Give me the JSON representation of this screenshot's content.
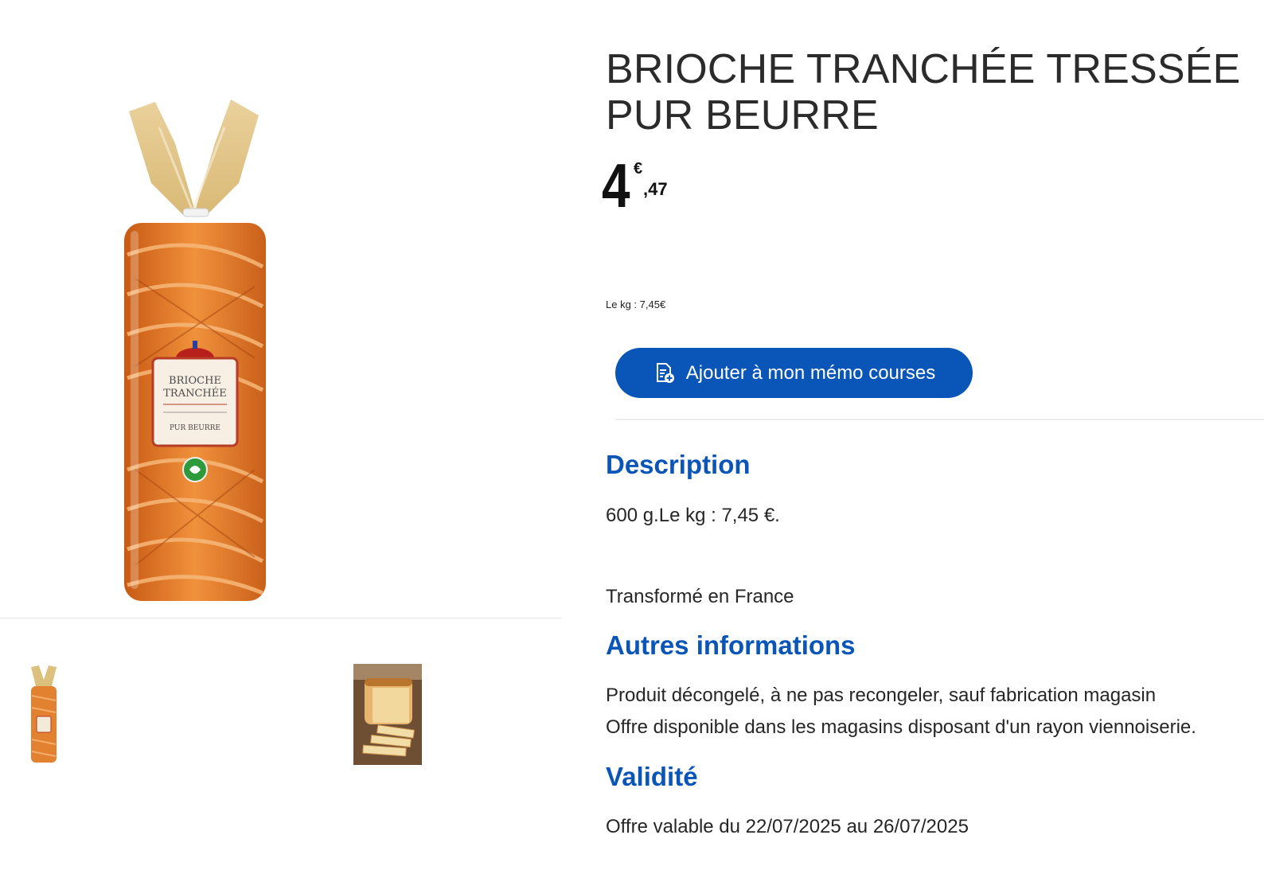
{
  "product": {
    "title": "BRIOCHE TRANCHÉE TRESSÉE PUR BEURRE",
    "price_int": "4",
    "price_currency": "€",
    "price_dec": ",47",
    "unit_price": "Le kg : 7,45€"
  },
  "packaging_text": {
    "line1": "BRIOCHE",
    "line2": "TRANCHÉE",
    "line3": "PUR BEURRE"
  },
  "actions": {
    "memo_label": "Ajouter à mon mémo courses"
  },
  "description": {
    "title": "Description",
    "line1": "600 g.Le kg : 7,45 €.",
    "line2": "Transformé en France"
  },
  "autres": {
    "title": "Autres informations",
    "line1": "Produit décongelé, à ne pas recongeler, sauf fabrication magasin",
    "line2": "Offre disponible dans les magasins disposant d'un rayon viennoiserie."
  },
  "validite": {
    "title": "Validité",
    "line1": "Offre valable du 22/07/2025 au 26/07/2025"
  },
  "colors": {
    "accent": "#0a56b8",
    "brioche": "#e07a2a"
  }
}
